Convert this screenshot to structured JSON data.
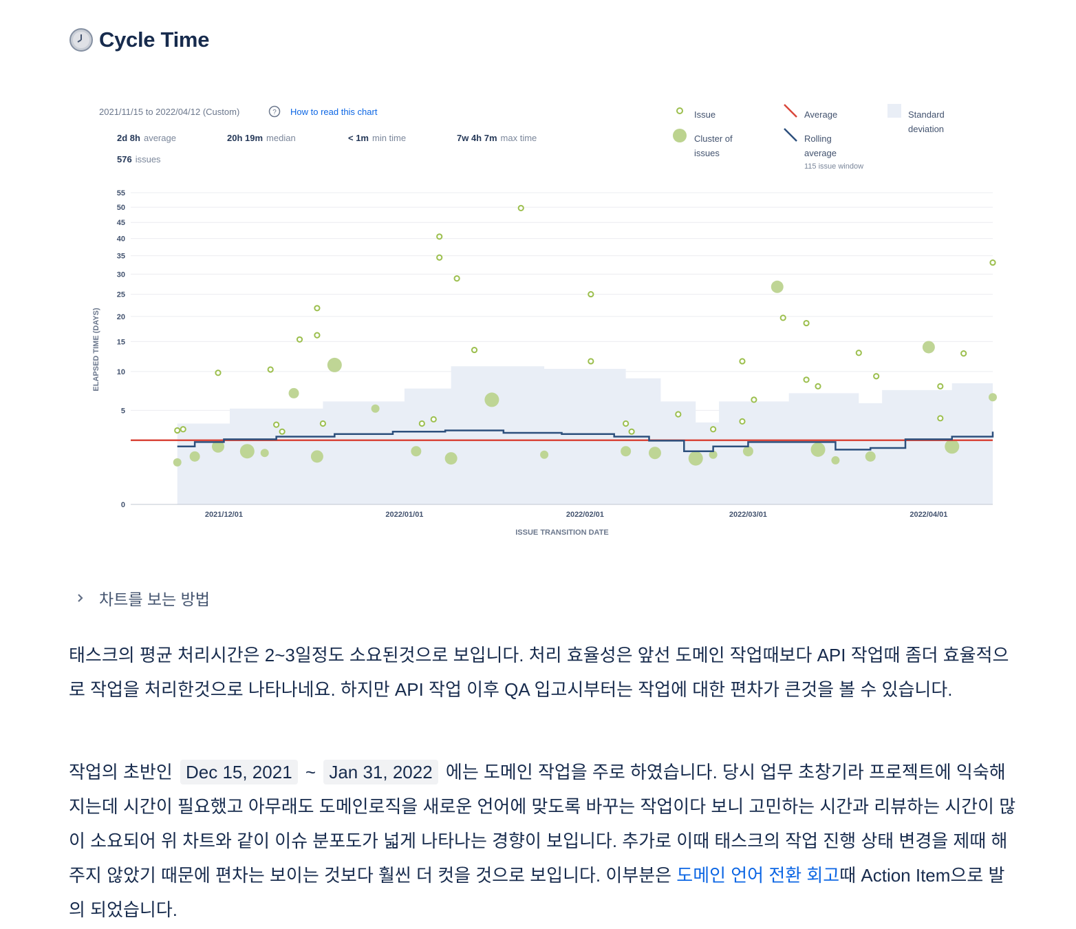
{
  "heading": {
    "title": "Cycle Time",
    "icon": "clock-icon"
  },
  "chart_header": {
    "range": "2021/11/15 to 2022/04/12 (Custom)",
    "help_link": "How to read this chart",
    "stats": [
      {
        "value": "2d 8h",
        "label": "average"
      },
      {
        "value": "20h 19m",
        "label": "median"
      },
      {
        "value": "< 1m",
        "label": "min time"
      },
      {
        "value": "7w 4h 7m",
        "label": "max time"
      }
    ],
    "issues_count": {
      "value": "576",
      "label": "issues"
    }
  },
  "legend": {
    "issue": "Issue",
    "cluster_line1": "Cluster of",
    "cluster_line2": "issues",
    "average": "Average",
    "rolling_line1": "Rolling",
    "rolling_line2": "average",
    "rolling_window": "115 issue window",
    "std_line1": "Standard",
    "std_line2": "deviation"
  },
  "colors": {
    "issue": "#9cbf4e",
    "average": "#d9463a",
    "rolling": "#2c4f7c",
    "std_dev": "#e9eef6"
  },
  "chart_data": {
    "type": "scatter",
    "title": "",
    "xlabel": "ISSUE TRANSITION DATE",
    "ylabel": "ELAPSED TIME (DAYS)",
    "xlim": [
      "2021-11-15",
      "2022-04-12"
    ],
    "x_ticks": [
      "2021/12/01",
      "2022/01/01",
      "2022/02/01",
      "2022/03/01",
      "2022/04/01"
    ],
    "y_ticks": [
      0,
      5,
      10,
      15,
      20,
      25,
      30,
      35,
      40,
      45,
      50,
      55
    ],
    "y_scale": "sqrt",
    "grid": true,
    "legend_position": "top-right",
    "average": 2.33,
    "issues": [
      {
        "x": "2021-11-23",
        "y": 3.1
      },
      {
        "x": "2021-11-24",
        "y": 3.2
      },
      {
        "x": "2021-11-30",
        "y": 9.8
      },
      {
        "x": "2021-12-09",
        "y": 10.3
      },
      {
        "x": "2021-12-10",
        "y": 3.6
      },
      {
        "x": "2021-12-11",
        "y": 3.0
      },
      {
        "x": "2021-12-14",
        "y": 15.4
      },
      {
        "x": "2021-12-17",
        "y": 21.8
      },
      {
        "x": "2021-12-17",
        "y": 16.2
      },
      {
        "x": "2021-12-18",
        "y": 3.7
      },
      {
        "x": "2022-01-04",
        "y": 3.7
      },
      {
        "x": "2022-01-06",
        "y": 4.1
      },
      {
        "x": "2022-01-07",
        "y": 40.6
      },
      {
        "x": "2022-01-07",
        "y": 34.5
      },
      {
        "x": "2022-01-10",
        "y": 28.9
      },
      {
        "x": "2022-01-13",
        "y": 13.5
      },
      {
        "x": "2022-01-21",
        "y": 49.7
      },
      {
        "x": "2022-02-02",
        "y": 25.0
      },
      {
        "x": "2022-02-02",
        "y": 11.6
      },
      {
        "x": "2022-02-08",
        "y": 3.7
      },
      {
        "x": "2022-02-09",
        "y": 3.0
      },
      {
        "x": "2022-02-17",
        "y": 4.6
      },
      {
        "x": "2022-02-23",
        "y": 3.2
      },
      {
        "x": "2022-02-28",
        "y": 11.6
      },
      {
        "x": "2022-02-28",
        "y": 3.9
      },
      {
        "x": "2022-03-02",
        "y": 6.2
      },
      {
        "x": "2022-03-07",
        "y": 19.7
      },
      {
        "x": "2022-03-11",
        "y": 18.6
      },
      {
        "x": "2022-03-11",
        "y": 8.8
      },
      {
        "x": "2022-03-13",
        "y": 7.9
      },
      {
        "x": "2022-03-20",
        "y": 13.0
      },
      {
        "x": "2022-03-23",
        "y": 9.3
      },
      {
        "x": "2022-04-03",
        "y": 7.9
      },
      {
        "x": "2022-04-03",
        "y": 4.2
      },
      {
        "x": "2022-04-07",
        "y": 12.9
      },
      {
        "x": "2022-04-12",
        "y": 33.1
      }
    ],
    "clusters": [
      {
        "x": "2021-11-23",
        "y": 1.0
      },
      {
        "x": "2021-11-26",
        "y": 1.3
      },
      {
        "x": "2021-11-30",
        "y": 1.9
      },
      {
        "x": "2021-12-05",
        "y": 1.6
      },
      {
        "x": "2021-12-08",
        "y": 1.5
      },
      {
        "x": "2021-12-13",
        "y": 7.0
      },
      {
        "x": "2021-12-17",
        "y": 1.3
      },
      {
        "x": "2021-12-20",
        "y": 11.0
      },
      {
        "x": "2021-12-27",
        "y": 5.2
      },
      {
        "x": "2022-01-03",
        "y": 1.6
      },
      {
        "x": "2022-01-09",
        "y": 1.2
      },
      {
        "x": "2022-01-16",
        "y": 6.2
      },
      {
        "x": "2022-01-25",
        "y": 1.4
      },
      {
        "x": "2022-02-08",
        "y": 1.6
      },
      {
        "x": "2022-02-13",
        "y": 1.5
      },
      {
        "x": "2022-02-20",
        "y": 1.2
      },
      {
        "x": "2022-02-23",
        "y": 1.4
      },
      {
        "x": "2022-03-01",
        "y": 1.6
      },
      {
        "x": "2022-03-06",
        "y": 26.8
      },
      {
        "x": "2022-03-13",
        "y": 1.7
      },
      {
        "x": "2022-03-16",
        "y": 1.1
      },
      {
        "x": "2022-03-22",
        "y": 1.3
      },
      {
        "x": "2022-04-01",
        "y": 14.0
      },
      {
        "x": "2022-04-05",
        "y": 1.9
      },
      {
        "x": "2022-04-12",
        "y": 6.5
      }
    ],
    "rolling_average": [
      {
        "x": "2021-11-23",
        "y": 1.9
      },
      {
        "x": "2021-11-26",
        "y": 2.2
      },
      {
        "x": "2021-12-01",
        "y": 2.4
      },
      {
        "x": "2021-12-10",
        "y": 2.6
      },
      {
        "x": "2021-12-20",
        "y": 2.8
      },
      {
        "x": "2021-12-30",
        "y": 3.0
      },
      {
        "x": "2022-01-08",
        "y": 3.1
      },
      {
        "x": "2022-01-18",
        "y": 2.9
      },
      {
        "x": "2022-01-28",
        "y": 2.8
      },
      {
        "x": "2022-02-06",
        "y": 2.6
      },
      {
        "x": "2022-02-12",
        "y": 2.3
      },
      {
        "x": "2022-02-18",
        "y": 1.6
      },
      {
        "x": "2022-02-23",
        "y": 1.9
      },
      {
        "x": "2022-03-01",
        "y": 2.2
      },
      {
        "x": "2022-03-10",
        "y": 2.2
      },
      {
        "x": "2022-03-16",
        "y": 1.7
      },
      {
        "x": "2022-03-22",
        "y": 1.8
      },
      {
        "x": "2022-03-28",
        "y": 2.4
      },
      {
        "x": "2022-04-05",
        "y": 2.6
      },
      {
        "x": "2022-04-12",
        "y": 3.0
      }
    ],
    "std_upper": [
      {
        "x": "2021-11-23",
        "y": 3.7
      },
      {
        "x": "2021-12-02",
        "y": 5.2
      },
      {
        "x": "2021-12-18",
        "y": 6.0
      },
      {
        "x": "2022-01-01",
        "y": 7.6
      },
      {
        "x": "2022-01-09",
        "y": 10.8
      },
      {
        "x": "2022-01-25",
        "y": 10.4
      },
      {
        "x": "2022-02-08",
        "y": 9.0
      },
      {
        "x": "2022-02-14",
        "y": 6.0
      },
      {
        "x": "2022-02-20",
        "y": 3.8
      },
      {
        "x": "2022-02-24",
        "y": 6.0
      },
      {
        "x": "2022-03-08",
        "y": 7.0
      },
      {
        "x": "2022-03-20",
        "y": 5.8
      },
      {
        "x": "2022-03-24",
        "y": 7.4
      },
      {
        "x": "2022-04-05",
        "y": 8.3
      },
      {
        "x": "2022-04-12",
        "y": 8.6
      }
    ]
  },
  "expand": {
    "label": "차트를 보는 방법"
  },
  "para1": {
    "text": "태스크의 평균 처리시간은 2~3일정도 소요된것으로 보입니다. 처리 효율성은 앞선 도메인 작업때보다 API 작업때 좀더 효율적으로 작업을 처리한것으로 나타나네요. 하지만 API 작업 이후 QA 입고시부터는 작업에 대한 편차가 큰것을 볼 수 있습니다."
  },
  "para2": {
    "lead": "작업의 초반인",
    "date_start": "Dec 15, 2021",
    "tilde": "~",
    "date_end": "Jan 31, 2022",
    "body": "에는 도메인 작업을 주로 하였습니다. 당시 업무 초창기라 프로젝트에 익숙해지는데 시간이 필요했고 아무래도 도메인로직을 새로운 언어에 맞도록 바꾸는 작업이다 보니 고민하는 시간과 리뷰하는 시간이 많이 소요되어 위 차트와 같이 이슈 분포도가 넓게 나타나는 경향이 보입니다. 추가로 이때 태스크의 작업 진행 상태 변경을 제때 해주지 않았기 때문에 편차는 보이는 것보다 훨씬 더 컷을 것으로 보입니다. 이부분은",
    "link": "도메인 언어 전환 회고",
    "tail": "때 Action Item으로 발의 되었습니다."
  }
}
